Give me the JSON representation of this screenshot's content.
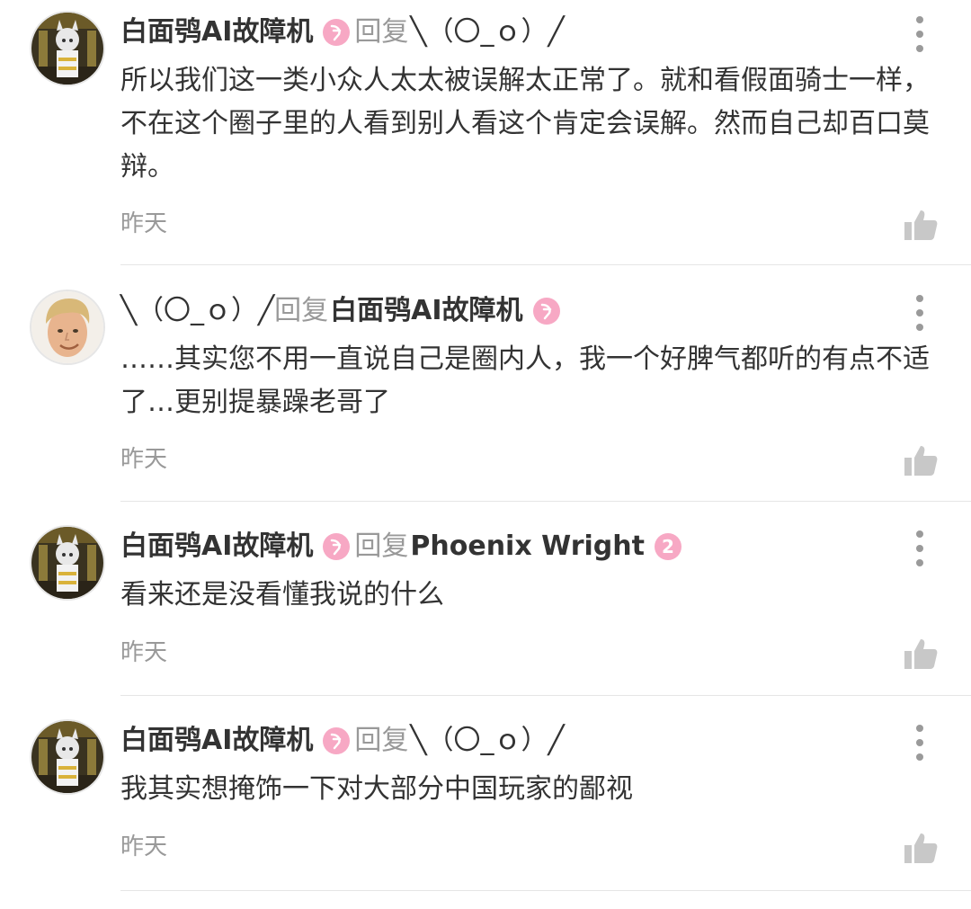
{
  "comments": [
    {
      "author": "白面鸮AI故障机",
      "avatar": "white-owl-character-avatar",
      "level_icon": "level-badge-pink",
      "reply_label": "回复",
      "reply_to": "╲（〇_ｏ）╱",
      "text": "所以我们这一类小众人太太被误解太正常了。就和看假面骑士一样，不在这个圈子里的人看到别人看这个肯定会误解。然而自己却百口莫辩。",
      "time": "昨天"
    },
    {
      "author": "╲（〇_ｏ）╱",
      "avatar": "blond-man-photo-avatar",
      "reply_label": "回复",
      "reply_to": "白面鸮AI故障机",
      "reply_level_icon": "level-badge-pink",
      "text": "……其实您不用一直说自己是圈内人，我一个好脾气都听的有点不适了…更别提暴躁老哥了",
      "time": "昨天"
    },
    {
      "author": "白面鸮AI故障机",
      "avatar": "white-owl-character-avatar",
      "level_icon": "level-badge-pink",
      "reply_label": "回复",
      "reply_to": "Phoenix Wright",
      "reply_level_icon": "level-badge-2",
      "reply_level_text": "2",
      "text": "看来还是没看懂我说的什么",
      "time": "昨天"
    },
    {
      "author": "白面鸮AI故障机",
      "avatar": "white-owl-character-avatar",
      "level_icon": "level-badge-pink",
      "reply_label": "回复",
      "reply_to": "╲（〇_ｏ）╱",
      "text": "我其实想掩饰一下对大部分中国玩家的鄙视",
      "time": "昨天"
    }
  ],
  "icons": {
    "more": "more-vertical-icon",
    "like": "thumbs-up-icon"
  },
  "colors": {
    "level_pink": "#f7a8c4",
    "meta_gray": "#999999",
    "text": "#333333"
  }
}
